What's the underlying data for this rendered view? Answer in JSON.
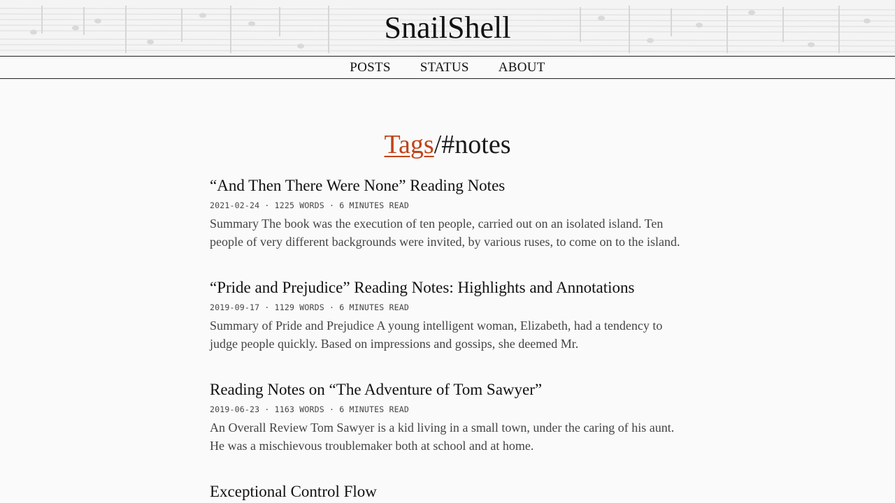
{
  "site": {
    "title": "SnailShell"
  },
  "nav": {
    "items": [
      {
        "label": "POSTS"
      },
      {
        "label": "STATUS"
      },
      {
        "label": "ABOUT"
      }
    ]
  },
  "heading": {
    "link_label": "Tags",
    "separator": "/",
    "tag": "#notes",
    "link_color": "#c0441a"
  },
  "posts": [
    {
      "title": "“And Then There Were None” Reading Notes",
      "meta": "2021-02-24 · 1225 WORDS · 6 MINUTES READ",
      "summary": "Summary The book was the execution of ten people, carried out on an isolated island. Ten people of very different backgrounds were invited, by various ruses, to come on to the island."
    },
    {
      "title": "“Pride and Prejudice” Reading Notes: Highlights and Annotations",
      "meta": "2019-09-17 · 1129 WORDS · 6 MINUTES READ",
      "summary": "Summary of Pride and Prejudice A young intelligent woman, Elizabeth, had a tendency to judge people quickly. Based on impressions and gossips, she deemed Mr."
    },
    {
      "title": "Reading Notes on “The Adventure of Tom Sawyer”",
      "meta": "2019-06-23 · 1163 WORDS · 6 MINUTES READ",
      "summary": "An Overall Review Tom Sawyer is a kid living in a small town, under the caring of his aunt. He was a mischievous troublemaker both at school and at home."
    },
    {
      "title": "Exceptional Control Flow",
      "meta": "",
      "summary": ""
    }
  ]
}
